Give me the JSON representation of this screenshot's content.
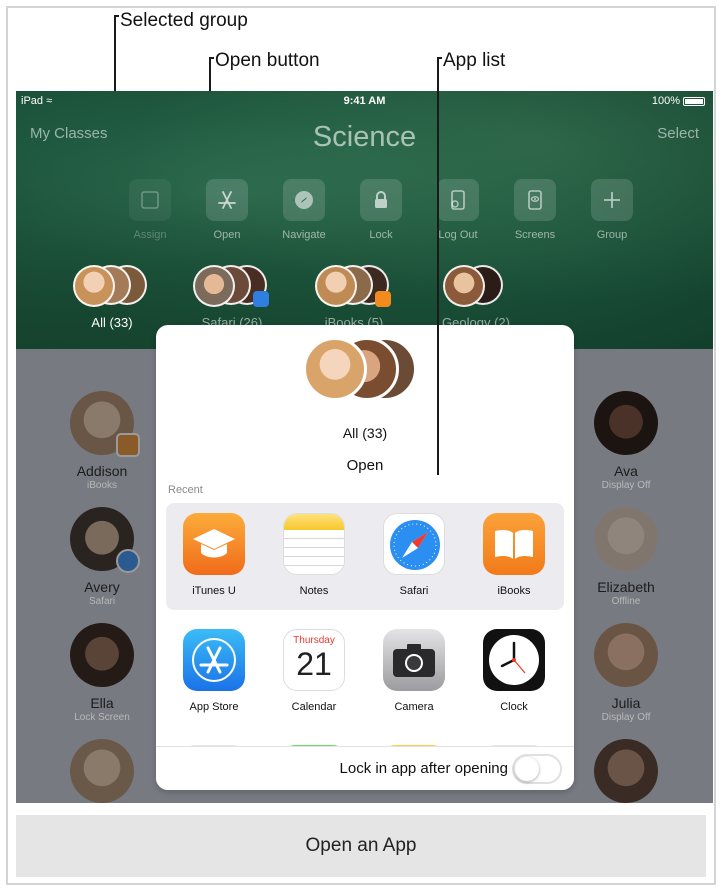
{
  "callouts": {
    "selected_group": "Selected group",
    "open_button": "Open button",
    "app_list": "App list"
  },
  "status_bar": {
    "device": "iPad",
    "time": "9:41 AM",
    "battery": "100%"
  },
  "nav": {
    "back": "My Classes",
    "title": "Science",
    "action": "Select"
  },
  "toolbar": [
    {
      "label": "Assign",
      "icon": "assign-icon"
    },
    {
      "label": "Open",
      "icon": "app-store-icon"
    },
    {
      "label": "Navigate",
      "icon": "compass-icon"
    },
    {
      "label": "Lock",
      "icon": "lock-icon"
    },
    {
      "label": "Log Out",
      "icon": "logout-icon"
    },
    {
      "label": "Screens",
      "icon": "screens-icon"
    },
    {
      "label": "Group",
      "icon": "plus-icon"
    }
  ],
  "groups": [
    {
      "label": "All (33)",
      "selected": true
    },
    {
      "label": "Safari (26)",
      "selected": false
    },
    {
      "label": "iBooks (5)",
      "selected": false
    },
    {
      "label": "Geology (2)",
      "selected": false
    }
  ],
  "students": [
    {
      "name": "Addison",
      "status": "iBooks"
    },
    {
      "name": "Avery",
      "status": "Safari"
    },
    {
      "name": "Ella",
      "status": "Lock Screen"
    },
    {
      "name": "Ava",
      "status": "Display Off"
    },
    {
      "name": "Elizabeth",
      "status": "Offline"
    },
    {
      "name": "Julia",
      "status": "Display Off"
    }
  ],
  "popover": {
    "group_label": "All (33)",
    "title": "Open",
    "recent_label": "Recent",
    "recent_apps": [
      {
        "label": "iTunes U",
        "icon": "itunes-u-icon"
      },
      {
        "label": "Notes",
        "icon": "notes-icon"
      },
      {
        "label": "Safari",
        "icon": "safari-icon"
      },
      {
        "label": "iBooks",
        "icon": "ibooks-icon"
      }
    ],
    "apps": [
      {
        "label": "App Store",
        "icon": "app-store-icon"
      },
      {
        "label": "Calendar",
        "icon": "calendar-icon"
      },
      {
        "label": "Camera",
        "icon": "camera-icon"
      },
      {
        "label": "Clock",
        "icon": "clock-icon"
      }
    ],
    "calendar_day": "Thursday",
    "calendar_date": "21",
    "lock_label": "Lock in app after opening",
    "lock_enabled": false
  },
  "caption": "Open an App"
}
